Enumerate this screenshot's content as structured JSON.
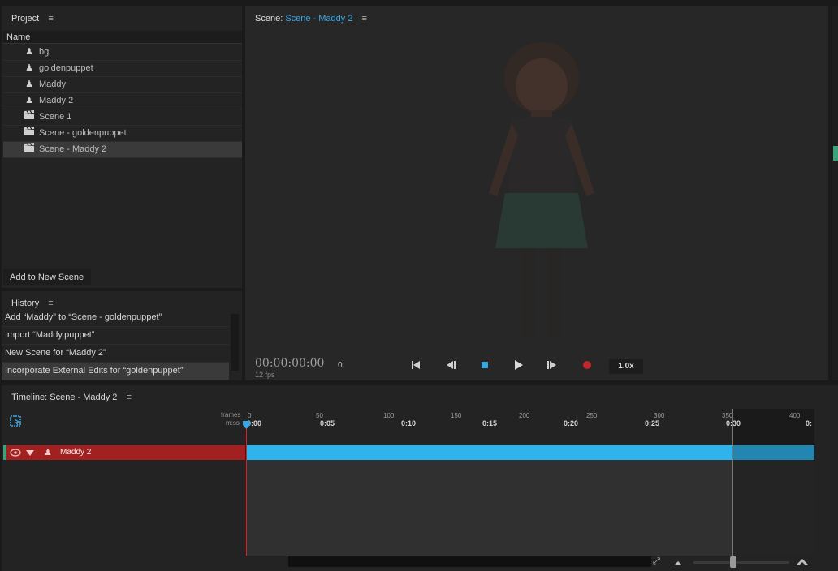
{
  "project": {
    "title": "Project",
    "menu_icon": "≡",
    "column_header": "Name",
    "items": [
      {
        "label": "bg",
        "icon": "puppet-icon"
      },
      {
        "label": "goldenpuppet",
        "icon": "puppet-icon"
      },
      {
        "label": "Maddy",
        "icon": "puppet-icon"
      },
      {
        "label": "Maddy 2",
        "icon": "puppet-icon"
      },
      {
        "label": "Scene 1",
        "icon": "scene-icon"
      },
      {
        "label": "Scene - goldenpuppet",
        "icon": "scene-icon"
      },
      {
        "label": "Scene - Maddy 2",
        "icon": "scene-icon",
        "selected": true
      }
    ],
    "add_button": "Add to New Scene"
  },
  "history": {
    "title": "History",
    "items": [
      "Add “Maddy” to “Scene - goldenpuppet”",
      "Import “Maddy.puppet”",
      "New Scene for “Maddy 2”",
      "Incorporate External Edits for “goldenpuppet”"
    ]
  },
  "scene": {
    "title_prefix": "Scene:",
    "title_name": "Scene - Maddy 2",
    "timecode": "00:00:00:00",
    "frame": "0",
    "fps": "12 fps",
    "speed": "1.0x"
  },
  "timeline": {
    "title": "Timeline: Scene - Maddy 2",
    "frames_label": "frames",
    "time_label": "m:ss",
    "frame_ticks": [
      "0",
      "50",
      "100",
      "150",
      "200",
      "250",
      "300",
      "350",
      "400"
    ],
    "time_ticks": [
      "0:00",
      "0:05",
      "0:10",
      "0:15",
      "0:20",
      "0:25",
      "0:30",
      "0:"
    ],
    "track_label": "Maddy 2"
  },
  "colors": {
    "accent": "#3ba7e4",
    "track_header": "#a32020",
    "track_bar": "#2fb3ec",
    "record": "#c0272d"
  }
}
